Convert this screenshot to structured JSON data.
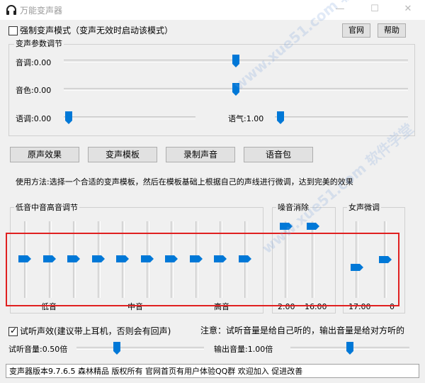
{
  "window": {
    "title": "万能变声器",
    "minimize": "—",
    "maximize": "☐",
    "close": "✕"
  },
  "top": {
    "force_mode_label": "强制变声模式（变声无效时启动该模式）",
    "force_mode_checked": false,
    "website_button": "官网",
    "help_button": "帮助"
  },
  "params": {
    "title": "变声参数调节",
    "pitch": {
      "label": "音调:0.00",
      "value": 0.0
    },
    "timbre": {
      "label": "音色:0.00",
      "value": 0.0
    },
    "speed": {
      "label": "语调:0.00",
      "value": 0.0
    },
    "tone": {
      "label": "语气:1.00",
      "value": 1.0
    }
  },
  "buttons": {
    "original": "原声效果",
    "templates": "变声模板",
    "record": "录制声音",
    "voice_pack": "语音包"
  },
  "usage_text": "使用方法:选择一个合适的变声模板，然后在模板基础上根据自己的声线进行微调，达到完美的效果",
  "equalizer": {
    "title": "低音中音高音调节",
    "low_label": "低音",
    "mid_label": "中音",
    "high_label": "高音",
    "band_count": 10
  },
  "noise": {
    "title": "噪音消除",
    "value1": "2.00",
    "value2": "16.00"
  },
  "female": {
    "title": "女声微调",
    "value1": "17.00",
    "value2": "0"
  },
  "monitor": {
    "checkbox_label": "试听声效(建议带上耳机，否则会有回声)",
    "checked": true,
    "note": "注意：试听音量是给自己听的，输出音量是给对方听的",
    "listen_volume_label": "试听音量:0.50倍",
    "listen_volume": 0.5,
    "output_volume_label": "输出音量:1.00倍",
    "output_volume": 1.0
  },
  "status": "变声器版本9.7.6.5  森林精品 版权所有  官网首页有用户体验QQ群 欢迎加入 促进改善",
  "watermark": "www.xue51.com 软件学堂",
  "colors": {
    "accent": "#0078d7",
    "highlight": "#e02020"
  }
}
